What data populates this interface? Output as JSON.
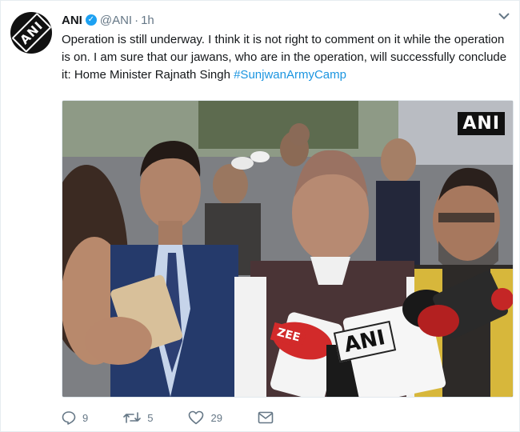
{
  "tweet": {
    "account_name": "ANI",
    "handle": "@ANI",
    "separator": "·",
    "time": "1h",
    "verified": true,
    "text_body": "Operation is still underway. I think it is not right to comment on it while the operation is on. I am sure that our jawans, who are in the operation, will successfully conclude it: Home Minister Rajnath Singh ",
    "hashtag": "#SunjwanArmyCamp"
  },
  "avatar": {
    "logo_text": "ANI"
  },
  "media": {
    "watermark": "ANI",
    "mic_label": "ANI",
    "mic_label_left": "ZEE"
  },
  "actions": {
    "reply_count": "9",
    "retweet_count": "5",
    "like_count": "29"
  },
  "colors": {
    "link": "#1b95e0",
    "verified": "#1da1f2",
    "muted": "#657786"
  },
  "icons": [
    "verified-icon",
    "caret-down-icon",
    "reply-icon",
    "retweet-icon",
    "like-icon",
    "direct-message-icon"
  ]
}
